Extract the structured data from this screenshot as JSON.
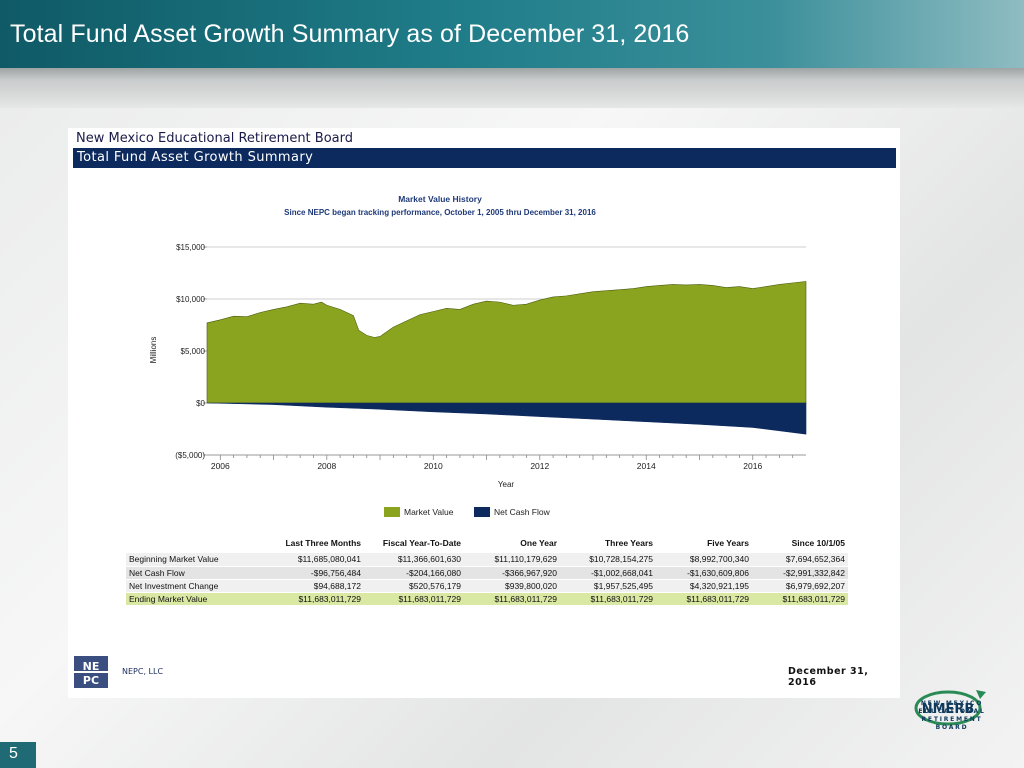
{
  "slide": {
    "title": "Total Fund Asset Growth Summary as of December 31, 2016",
    "page_number": "5"
  },
  "report": {
    "org_name": "New Mexico Educational Retirement Board",
    "section_title": "Total Fund Asset Growth Summary",
    "company": "NEPC, LLC",
    "logo_text": "NEPC",
    "date": "December 31, 2016",
    "nmerb_text": "NEW MEXICO EDUCATIONAL RETIREMENT BOARD",
    "nmerb_logo": "NMERB"
  },
  "chart_data": {
    "type": "area",
    "title": "Market Value History",
    "subtitle": "Since NEPC began tracking performance, October 1, 2005 thru December 31, 2016",
    "xlabel": "Year",
    "ylabel": "Millions",
    "xlim": [
      2005.75,
      2017.0
    ],
    "ylim": [
      -5000,
      15000
    ],
    "x_ticks": [
      2006,
      2008,
      2010,
      2012,
      2014,
      2016
    ],
    "y_ticks": [
      {
        "value": 15000,
        "label": "$15,000"
      },
      {
        "value": 10000,
        "label": "$10,000"
      },
      {
        "value": 5000,
        "label": "$5,000"
      },
      {
        "value": 0,
        "label": "$0"
      },
      {
        "value": -5000,
        "label": "($5,000)"
      }
    ],
    "grid": "horizontal",
    "legend_position": "bottom",
    "series": [
      {
        "name": "Market Value",
        "color": "#8ba420",
        "x": [
          2005.75,
          2006.0,
          2006.25,
          2006.5,
          2006.75,
          2007.0,
          2007.25,
          2007.5,
          2007.75,
          2007.9,
          2008.0,
          2008.25,
          2008.5,
          2008.6,
          2008.75,
          2008.9,
          2009.0,
          2009.25,
          2009.5,
          2009.75,
          2010.0,
          2010.25,
          2010.5,
          2010.75,
          2011.0,
          2011.25,
          2011.5,
          2011.75,
          2012.0,
          2012.25,
          2012.5,
          2012.75,
          2013.0,
          2013.25,
          2013.5,
          2013.75,
          2014.0,
          2014.25,
          2014.5,
          2014.75,
          2015.0,
          2015.25,
          2015.5,
          2015.75,
          2016.0,
          2016.25,
          2016.5,
          2016.75,
          2017.0
        ],
        "values": [
          7700,
          8000,
          8350,
          8300,
          8700,
          9000,
          9250,
          9600,
          9500,
          9700,
          9400,
          9000,
          8400,
          7000,
          6500,
          6300,
          6400,
          7300,
          7900,
          8500,
          8800,
          9100,
          9000,
          9500,
          9800,
          9700,
          9400,
          9500,
          9900,
          10200,
          10300,
          10500,
          10700,
          10800,
          10900,
          11000,
          11200,
          11300,
          11400,
          11350,
          11400,
          11300,
          11100,
          11200,
          11000,
          11200,
          11400,
          11550,
          11683
        ]
      },
      {
        "name": "Net Cash Flow",
        "color": "#0d2a5e",
        "x": [
          2005.75,
          2007.0,
          2008.0,
          2009.0,
          2010.0,
          2011.0,
          2012.0,
          2013.0,
          2014.0,
          2015.0,
          2016.0,
          2017.0
        ],
        "values": [
          0,
          -150,
          -400,
          -600,
          -850,
          -1050,
          -1300,
          -1550,
          -1800,
          -2050,
          -2350,
          -2991
        ]
      }
    ]
  },
  "table": {
    "columns": [
      "",
      "Last Three Months",
      "Fiscal Year-To-Date",
      "One Year",
      "Three Years",
      "Five Years",
      "Since 10/1/05"
    ],
    "rows": [
      [
        "Beginning Market Value",
        "$11,685,080,041",
        "$11,366,601,630",
        "$11,110,179,629",
        "$10,728,154,275",
        "$8,992,700,340",
        "$7,694,652,364"
      ],
      [
        "Net Cash Flow",
        "-$96,756,484",
        "-$204,166,080",
        "-$366,967,920",
        "-$1,002,668,041",
        "-$1,630,609,806",
        "-$2,991,332,842"
      ],
      [
        "Net Investment Change",
        "$94,688,172",
        "$520,576,179",
        "$939,800,020",
        "$1,957,525,495",
        "$4,320,921,195",
        "$6,979,692,207"
      ],
      [
        "Ending Market Value",
        "$11,683,011,729",
        "$11,683,011,729",
        "$11,683,011,729",
        "$11,683,011,729",
        "$11,683,011,729",
        "$11,683,011,729"
      ]
    ]
  }
}
